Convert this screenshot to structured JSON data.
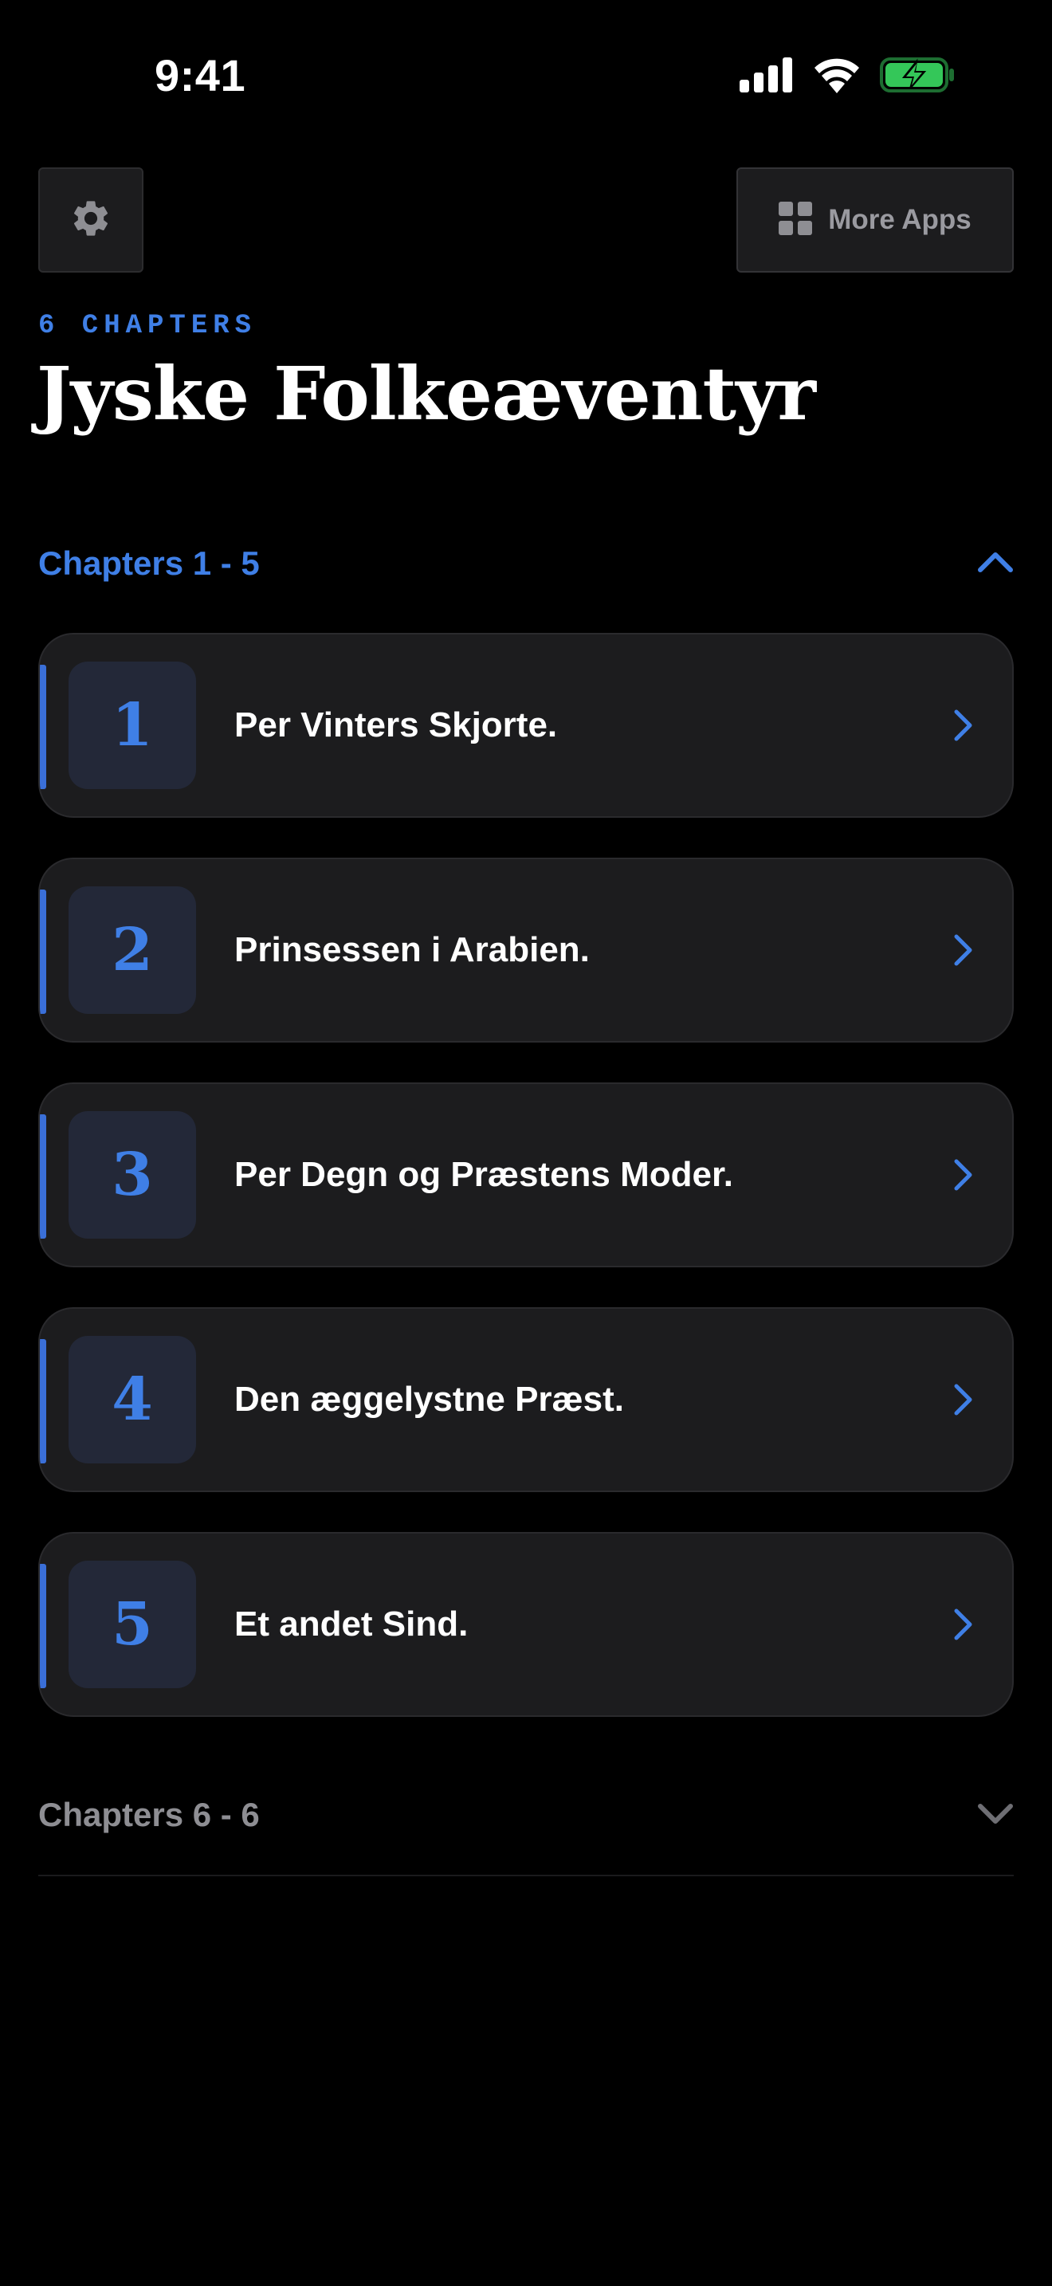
{
  "status_bar": {
    "time": "9:41",
    "icons": [
      "cellular-signal-icon",
      "wifi-icon",
      "battery-charging-icon"
    ]
  },
  "toolbar": {
    "settings_icon": "gear-icon",
    "more_apps_label": "More Apps",
    "more_apps_icon": "grid-icon"
  },
  "header": {
    "eyebrow": "6 CHAPTERS",
    "title": "Jyske Folkeæventyr"
  },
  "sections": [
    {
      "label": "Chapters 1 - 5",
      "expanded": true,
      "chapters": [
        {
          "number": "1",
          "title": "Per Vinters Skjorte."
        },
        {
          "number": "2",
          "title": "Prinsessen i Arabien."
        },
        {
          "number": "3",
          "title": "Per Degn og Præstens Moder."
        },
        {
          "number": "4",
          "title": "Den æggelystne Præst."
        },
        {
          "number": "5",
          "title": "Et andet Sind."
        }
      ]
    },
    {
      "label": "Chapters 6 - 6",
      "expanded": false
    }
  ],
  "colors": {
    "accent": "#3f7fe6",
    "background": "#000000",
    "card": "#1c1c1e",
    "muted": "#8e8e93",
    "battery": "#34c759"
  }
}
